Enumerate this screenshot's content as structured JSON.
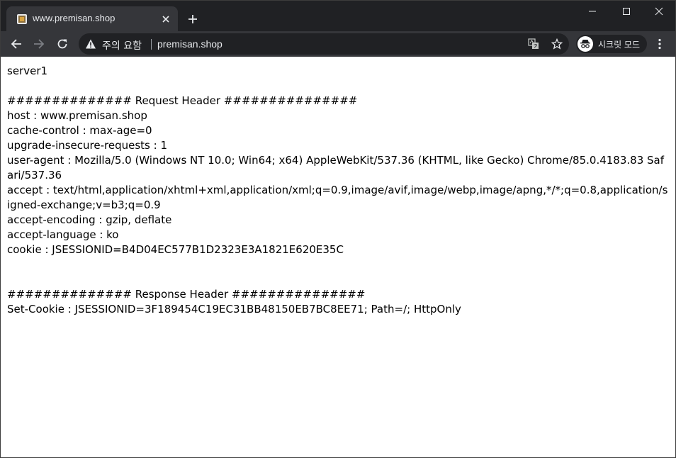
{
  "tab": {
    "title": "www.premisan.shop"
  },
  "toolbar": {
    "security_label": "주의 요함",
    "url": "premisan.shop",
    "profile_label": "시크릿 모드"
  },
  "page": {
    "lines": [
      "server1",
      "",
      "############## Request Header ###############",
      "host : www.premisan.shop",
      "cache-control : max-age=0",
      "upgrade-insecure-requests : 1",
      "user-agent : Mozilla/5.0 (Windows NT 10.0; Win64; x64) AppleWebKit/537.36 (KHTML, like Gecko) Chrome/85.0.4183.83 Safari/537.36",
      "accept : text/html,application/xhtml+xml,application/xml;q=0.9,image/avif,image/webp,image/apng,*/*;q=0.8,application/signed-exchange;v=b3;q=0.9",
      "accept-encoding : gzip, deflate",
      "accept-language : ko",
      "cookie : JSESSIONID=B4D04EC577B1D2323E3A1821E620E35C",
      "",
      "",
      "############## Response Header ###############",
      "Set-Cookie : JSESSIONID=3F189454C19EC31BB48150EB7BC8EE71; Path=/; HttpOnly"
    ]
  }
}
